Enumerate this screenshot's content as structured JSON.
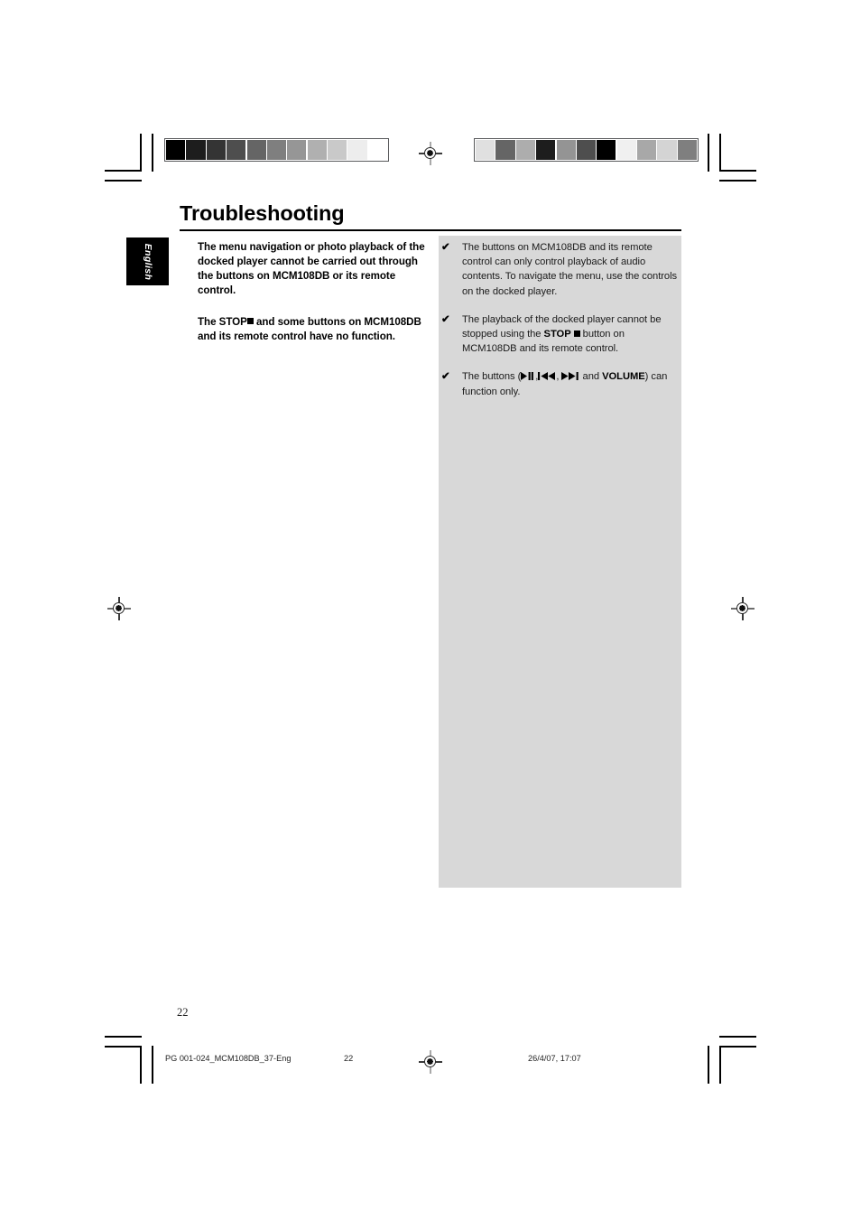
{
  "document": {
    "page_title": "Troubleshooting",
    "page_number": "22",
    "language_tab": "English"
  },
  "left_column": {
    "paragraphs": [
      "The menu navigation or photo playback of the docked player cannot be carried out through the buttons on MCM108DB or its remote control.",
      "The STOP ■ and some buttons on MCM108DB and its remote control have no function."
    ],
    "para_2_prefix": "The ",
    "para_2_stop": "STOP",
    "para_2_suffix": " and some buttons on MCM108DB and its remote control have no function."
  },
  "right_column": {
    "bullet_marker": "✔",
    "bullets": [
      {
        "text": "The buttons on MCM108DB and its remote control can only control playback of audio contents. To navigate the menu, use the controls on the docked player."
      },
      {
        "prefix": "The playback of the docked player cannot be stopped using the ",
        "bold": "STOP",
        "suffix": " button on MCM108DB and its remote control."
      },
      {
        "prefix": "The buttons (",
        "icons": [
          "play-pause-icon",
          "previous-track-icon",
          "next-track-icon"
        ],
        "middle": " and ",
        "bold": "VOLUME",
        "suffix": ") can function only."
      }
    ]
  },
  "footer": {
    "file_label": "PG 001-024_MCM108DB_37-Eng",
    "page_number": "22",
    "timestamp": "26/4/07, 17:07"
  },
  "print_marks": {
    "swatch_bar_left": [
      "#000000",
      "#1d1d1d",
      "#343434",
      "#4e4e4e",
      "#656565",
      "#7f7f7f",
      "#969696",
      "#b0b0b0",
      "#c9c9c9",
      "#ededed",
      "#ffffff"
    ],
    "swatch_bar_right": [
      "#e0e0e0",
      "#656565",
      "#adadad",
      "#1d1d1d",
      "#949494",
      "#4e4e4e",
      "#000000",
      "#f0f0f0",
      "#a8a8a8",
      "#d4d4d4",
      "#7f7f7f"
    ],
    "registration_icon": "registration-target-icon",
    "crop_mark_icon": "crop-mark-icon"
  },
  "colors": {
    "panel_gray": "#d8d8d8",
    "ink_black": "#000000",
    "body_text": "#1a1a1a"
  }
}
